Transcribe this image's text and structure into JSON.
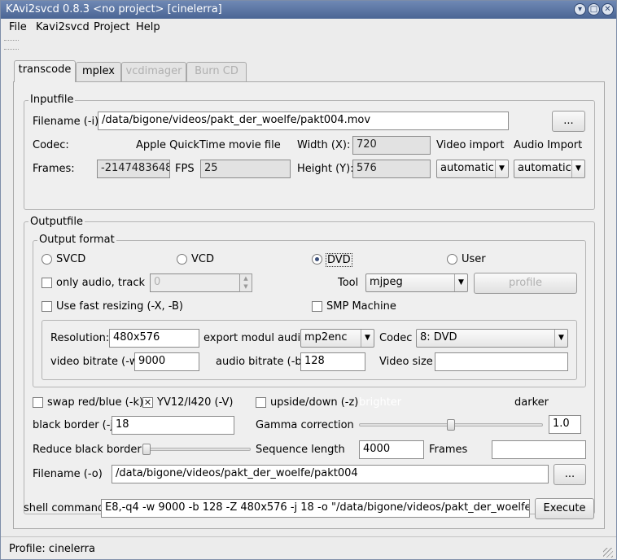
{
  "window": {
    "title": "KAvi2svcd 0.8.3 <no project> [cinelerra]"
  },
  "menu": {
    "file": "File",
    "kavi2svcd": "Kavi2svcd",
    "project": "Project",
    "help": "Help"
  },
  "tabs": [
    {
      "label": "transcode",
      "state": "active"
    },
    {
      "label": "mplex",
      "state": "normal"
    },
    {
      "label": "vcdimager",
      "state": "disabled"
    },
    {
      "label": "Burn CD",
      "state": "disabled"
    }
  ],
  "inputfile": {
    "group_label": "Inputfile",
    "filename_label": "Filename (-i)",
    "filename_value": "/data/bigone/videos/pakt_der_woelfe/pakt004.mov",
    "browse_label": "...",
    "codec_label": "Codec:",
    "codec_value": "Apple QuickTime movie file",
    "width_label": "Width (X):",
    "width_value": "720",
    "height_label": "Height (Y):",
    "height_value": "576",
    "frames_label": "Frames:",
    "frames_value": "-2147483648",
    "fps_label": "FPS",
    "fps_value": "25",
    "video_import_label": "Video import",
    "video_import_value": "automatic",
    "audio_import_label": "Audio Import",
    "audio_import_value": "automatic"
  },
  "outputfile": {
    "group_label": "Outputfile",
    "format_group_label": "Output format",
    "formats": {
      "svcd": "SVCD",
      "vcd": "VCD",
      "dvd": "DVD",
      "user": "User"
    },
    "selected_format": "DVD",
    "only_audio_label": "only audio, track",
    "only_audio_value": "0",
    "tool_label": "Tool",
    "tool_value": "mjpeg",
    "profile_label": "profile",
    "fast_resize_label": "Use fast resizing (-X, -B)",
    "smp_label": "SMP Machine",
    "resolution_label": "Resolution:",
    "resolution_value": "480x576",
    "export_audio_label": "export modul audio",
    "export_audio_value": "mp2enc",
    "codec_label": "Codec",
    "codec_value": "8: DVD",
    "video_bitrate_label": "video bitrate (-w)",
    "video_bitrate_value": "9000",
    "audio_bitrate_label": "audio bitrate (-b):",
    "audio_bitrate_value": "128",
    "video_size_label": "Video size",
    "video_size_value": "",
    "swap_label": "swap red/blue (-k)",
    "yv12_label": "YV12/I420 (-V)",
    "upside_label": "upside/down (-z)",
    "brighter_label": "brighter",
    "darker_label": "darker",
    "black_border_label": "black border (-j)",
    "black_border_value": "18",
    "gamma_label": "Gamma correction",
    "gamma_value": "1.0",
    "gamma_slider_level": 0.5,
    "reduce_border_label": "Reduce black border",
    "reduce_slider_level": 0.0,
    "sequence_label": "Sequence length",
    "sequence_value": "4000",
    "frames_label": "Frames",
    "frames_value": "",
    "filename_label": "Filename (-o)",
    "filename_value": "/data/bigone/videos/pakt_der_woelfe/pakt004",
    "browse_label": "..."
  },
  "shell": {
    "label": "shell command",
    "value": "E8,-q4 -w 9000 -b 128 -Z 480x576 -j 18 -o \"/data/bigone/videos/pakt_der_woelfe/pakt004\"",
    "execute_label": "Execute"
  },
  "status": {
    "profile_text": "Profile: cinelerra"
  },
  "colors": {
    "titlebar": "#4a6594",
    "radio_selected": "#3b4f7a"
  },
  "icons": {
    "close": "close-icon",
    "minimize": "minimize-icon",
    "maximize": "maximize-icon"
  }
}
